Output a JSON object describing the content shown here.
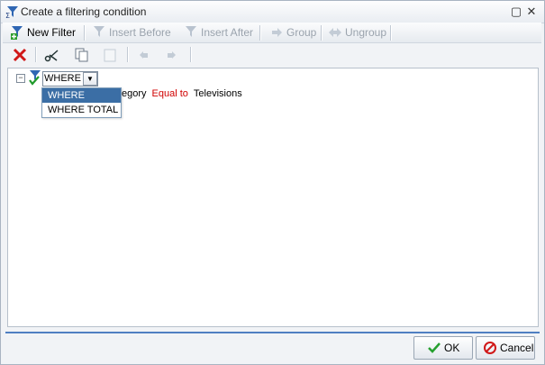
{
  "window": {
    "title": "Create a filtering condition"
  },
  "toolbar": {
    "new_filter": "New Filter",
    "insert_before": "Insert Before",
    "insert_after": "Insert After",
    "group": "Group",
    "ungroup": "Ungroup"
  },
  "tree": {
    "where_value": "WHERE",
    "dropdown_options": [
      "WHERE",
      "WHERE TOTAL"
    ],
    "condition_field": "egory",
    "condition_operator": "Equal to",
    "condition_value": "Televisions"
  },
  "footer": {
    "ok_label": "OK",
    "cancel_label": "Cancel"
  },
  "colors": {
    "accent": "#4f7fc2",
    "selection": "#3b6ea5",
    "operator": "#d00000"
  }
}
